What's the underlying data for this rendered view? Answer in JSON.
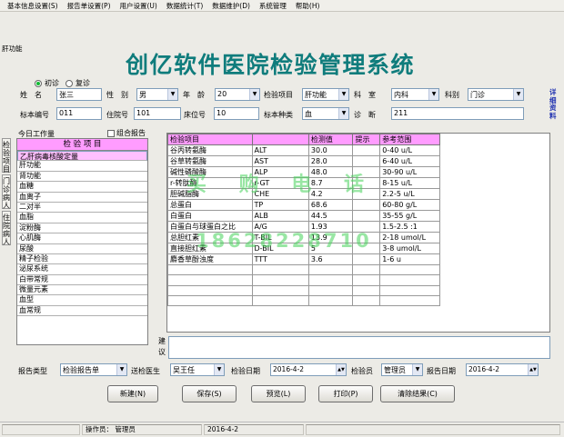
{
  "menu": [
    "基本信息设置(S)",
    "报告单设置(P)",
    "用户设置(U)",
    "数据统计(T)",
    "数据维护(D)",
    "系统管理",
    "帮助(H)"
  ],
  "window_caption": "肝功能",
  "title": "创亿软件医院检验管理系统",
  "side_link": "详细资料",
  "radios": {
    "first": "初诊",
    "repeat": "复诊",
    "selected": "first"
  },
  "form": {
    "name_label": "姓　名",
    "name_value": "张三",
    "sex_label": "性　别",
    "sex_value": "男",
    "age_label": "年　龄",
    "age_value": "20",
    "item_label": "检验项目",
    "item_value": "肝功能",
    "dept_label": "科　室",
    "dept_value": "内科",
    "type_label": "科别",
    "type_value": "门诊",
    "sample_no_label": "标本编号",
    "sample_no_value": "011",
    "inpatient_label": "住院号",
    "inpatient_value": "101",
    "bed_label": "床位号",
    "bed_value": "10",
    "sample_kind_label": "标本种类",
    "sample_kind_value": "血",
    "diag_label": "诊　断",
    "diag_value": "211"
  },
  "today_label": "今日工作量",
  "combo_label": "组合报告",
  "vtabs": [
    "检验项目",
    "门诊病人",
    "住院病人"
  ],
  "list": {
    "header": "检 验 项 目",
    "items": [
      "乙肝病毒核酸定量",
      "肝功能",
      "肾功能",
      "血糖",
      "血离子",
      "二对半",
      "血脂",
      "淀粉酶",
      "心肌酶",
      "尿酸",
      "精子检验",
      "泌尿系统",
      "白带常规",
      "微量元素",
      "血型",
      "血常规"
    ],
    "selected_index": 0
  },
  "grid": {
    "columns": [
      "检验项目",
      "",
      "检测值",
      "提示",
      "参考范围"
    ],
    "rows": [
      [
        "谷丙转氨酶",
        "ALT",
        "30.0",
        "",
        "0-40 u/L"
      ],
      [
        "谷草转氨酶",
        "AST",
        "28.0",
        "",
        "6-40 u/L"
      ],
      [
        "碱性磷酸酶",
        "ALP",
        "48.0",
        "",
        "30-90 u/L"
      ],
      [
        "r-转肽酶",
        "r-GT",
        "8.7",
        "",
        "8-15 u/L"
      ],
      [
        "胆碱脂酶",
        "CHE",
        "4.2",
        "",
        "2.2-5 u/L"
      ],
      [
        "总蛋白",
        "TP",
        "68.6",
        "",
        "60-80 g/L"
      ],
      [
        "白蛋白",
        "ALB",
        "44.5",
        "",
        "35-55 g/L"
      ],
      [
        "白蛋白与球蛋白之比",
        "A/G",
        "1.93",
        "",
        "1.5-2.5 :1"
      ],
      [
        "总胆红素",
        "T-BIL",
        "13.9",
        "",
        "2-18 umol/L"
      ],
      [
        "直接胆红素",
        "D-BIL",
        "5",
        "",
        "3-8 umol/L"
      ],
      [
        "麝香草酚浊度",
        "TTT",
        "3.6",
        "",
        "1-6 u"
      ]
    ]
  },
  "watermark": {
    "line1": "买 购 电 话",
    "line2": "18628228710"
  },
  "suggest_label": "建议",
  "bottom": {
    "report_type_label": "报告类型",
    "report_type_value": "检验报告单",
    "doctor_label": "送检医生",
    "doctor_value": "吴王任",
    "test_date_label": "检验日期",
    "test_date_value": "2016-4-2",
    "tester_label": "检验员",
    "tester_value": "管理员",
    "report_date_label": "报告日期",
    "report_date_value": "2016-4-2"
  },
  "buttons": [
    "新建(N)",
    "保存(S)",
    "预览(L)",
    "打印(P)",
    "清除结果(C)"
  ],
  "status": {
    "operator_label": "操作员：",
    "operator_value": "管理员",
    "date": "2016-4-2"
  }
}
